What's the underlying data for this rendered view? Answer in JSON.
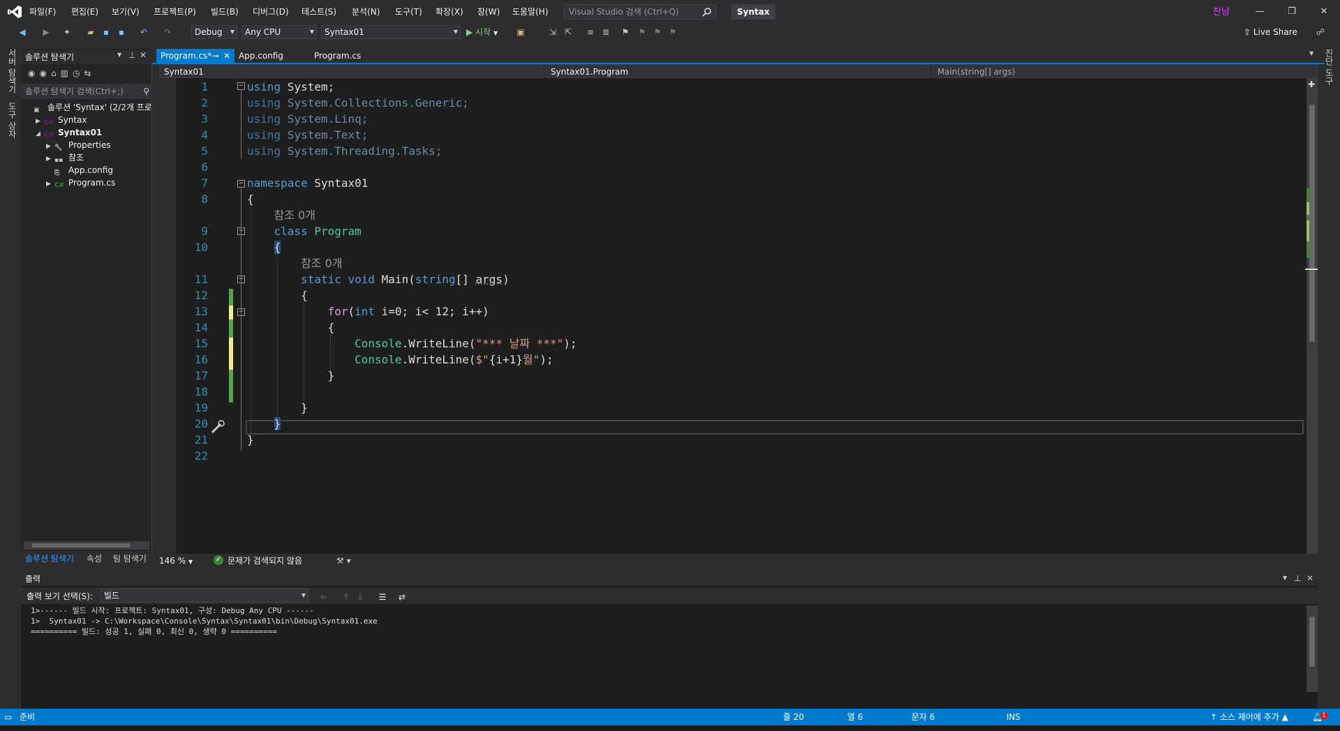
{
  "title_bar": {
    "menus": [
      "파일(F)",
      "편집(E)",
      "보기(V)",
      "프로젝트(P)",
      "빌드(B)",
      "디버그(D)",
      "테스트(S)",
      "분석(N)",
      "도구(T)",
      "확장(X)",
      "창(W)",
      "도움말(H)"
    ],
    "search_placeholder": "Visual Studio 검색 (Ctrl+Q)",
    "solution_name": "Syntax",
    "user": "찬남",
    "min": "—",
    "max": "❐",
    "close": "✕"
  },
  "toolbar": {
    "config": "Debug",
    "platform": "Any CPU",
    "startup_project": "Syntax01",
    "start_label": "▶ 시작",
    "live_share": "Live Share"
  },
  "left_vtabs": {
    "server_explorer": "서버 탐색기",
    "toolbox": "도구 상자"
  },
  "right_vtabs": {
    "diagnostics": "진단 도구"
  },
  "solution_explorer": {
    "title": "솔루션 탐색기",
    "search_placeholder": "솔루션 탐색기 검색(Ctrl+;)",
    "tree": [
      {
        "label": "솔루션 'Syntax' (2/2개 프로젝트)",
        "indent": 0,
        "toggle": "",
        "icon": "solution-icon",
        "bold": false
      },
      {
        "label": "Syntax",
        "indent": 1,
        "toggle": "▶",
        "icon": "csharp-project-icon",
        "bold": false
      },
      {
        "label": "Syntax01",
        "indent": 1,
        "toggle": "◢",
        "icon": "csharp-project-icon",
        "bold": true
      },
      {
        "label": "Properties",
        "indent": 2,
        "toggle": "▶",
        "icon": "wrench-icon",
        "bold": false
      },
      {
        "label": "참조",
        "indent": 2,
        "toggle": "▶",
        "icon": "references-icon",
        "bold": false
      },
      {
        "label": "App.config",
        "indent": 2,
        "toggle": "",
        "icon": "config-file-icon",
        "bold": false
      },
      {
        "label": "Program.cs",
        "indent": 2,
        "toggle": "▶",
        "icon": "csharp-file-icon",
        "bold": false
      }
    ],
    "bottom_tabs": [
      "솔루션 탐색기",
      "속성",
      "팀 탐색기"
    ]
  },
  "doc_tabs": [
    {
      "label": "Program.cs*",
      "active": true
    },
    {
      "label": "App.config",
      "active": false
    },
    {
      "label": "Program.cs",
      "active": false
    }
  ],
  "nav_bar": {
    "project": "Syntax01",
    "type": "Syntax01.Program",
    "member": "Main(string[] args)"
  },
  "editor": {
    "line_numbers": [
      "1",
      "2",
      "3",
      "4",
      "5",
      "6",
      "7",
      "8",
      "",
      "9",
      "10",
      "",
      "11",
      "12",
      "13",
      "14",
      "15",
      "16",
      "17",
      "18",
      "19",
      "20",
      "21",
      "22"
    ],
    "ref_count_label": "참조 0개",
    "zoom": "146 %",
    "issues": "문제가 검색되지 않음"
  },
  "output": {
    "title": "출력",
    "source_label": "출력 보기 선택(S):",
    "source_value": "빌드",
    "lines": [
      "1>------ 빌드 시작: 프로젝트: Syntax01, 구성: Debug Any CPU ------",
      "1>  Syntax01 -> C:\\Workspace\\Console\\Syntax\\Syntax01\\bin\\Debug\\Syntax01.exe",
      "========== 빌드: 성공 1, 실패 0, 최신 0, 생략 0 =========="
    ]
  },
  "status_bar": {
    "ready": "준비",
    "line": "줄 20",
    "col": "열 6",
    "char": "문자 6",
    "mode": "INS",
    "source_control": "소스 제어에 추가",
    "notifications": "1"
  }
}
